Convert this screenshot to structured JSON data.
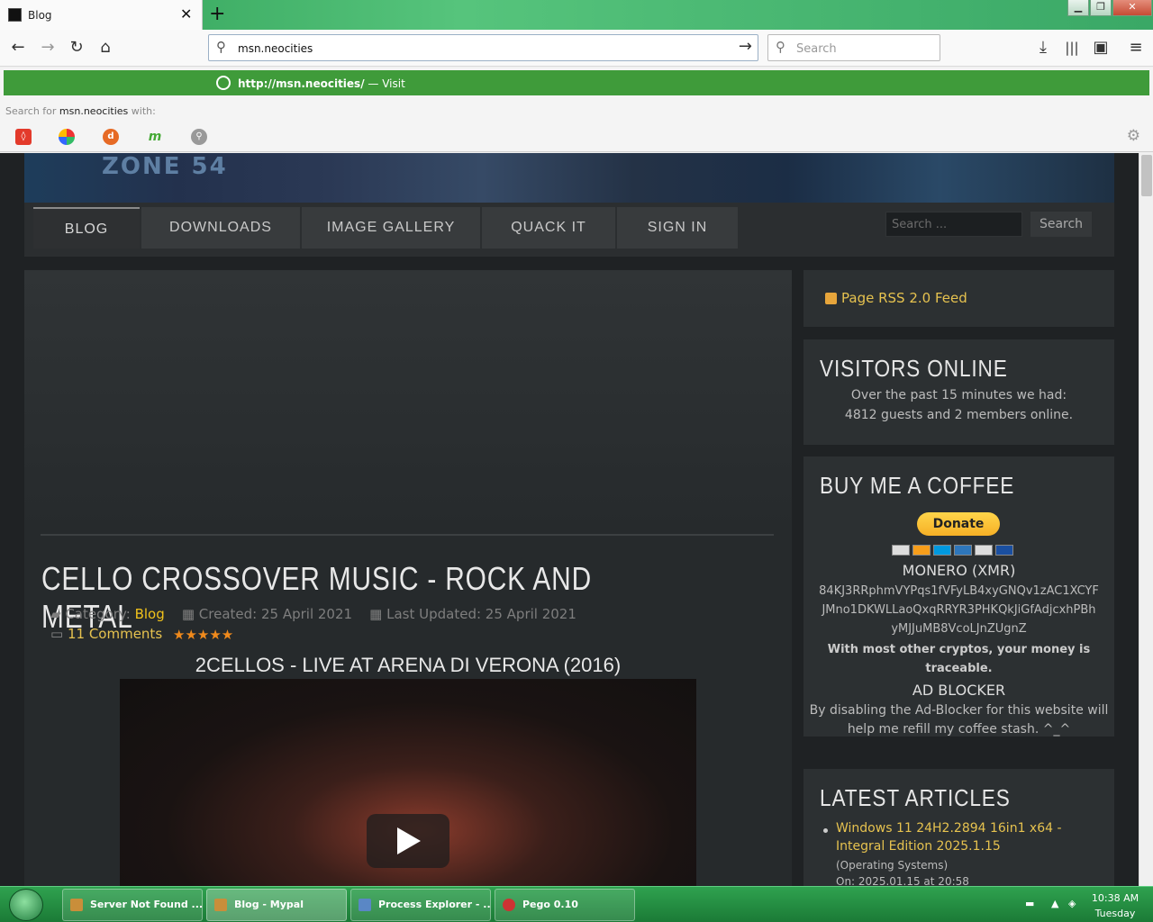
{
  "browser": {
    "tab_title": "Blog",
    "tab_close": "✕",
    "new_tab": "+",
    "url": "msn.neocities",
    "search_placeholder": "Search",
    "dropdown": {
      "visit_url_bold": "http://msn.neocities/",
      "visit_suffix": " — Visit",
      "search_for_prefix": "Search for ",
      "search_for_term": "msn.neocities",
      "search_for_suffix": " with:"
    },
    "window_buttons": {
      "minimize": "▁",
      "maximize": "❐",
      "close": "✕"
    }
  },
  "site": {
    "banner_logo": "ZONE 54",
    "menu": [
      "BLOG",
      "DOWNLOADS",
      "IMAGE GALLERY",
      "QUACK IT",
      "SIGN IN"
    ],
    "search_placeholder": "Search ...",
    "search_button": "Search",
    "article": {
      "title": "CELLO CROSSOVER MUSIC - ROCK AND METAL",
      "category_label": "Category: ",
      "category": "Blog",
      "created": "Created: 25 April 2021",
      "updated": "Last Updated: 25 April 2021",
      "comments": "11 Comments",
      "rating_stars": "★★★★★",
      "video_title": "2CELLOS - LIVE AT ARENA DI VERONA (2016)"
    },
    "sidebar": {
      "rss": "Page RSS 2.0 Feed",
      "visitors_title": "VISITORS ONLINE",
      "visitors_line1": "Over the past 15 minutes we had:",
      "visitors_line2": "4812 guests and 2 members online.",
      "coffee_title": "BUY ME A COFFEE",
      "donate": "Donate",
      "monero_title": "MONERO (XMR)",
      "monero_addr1": "84KJ3RRphmVYPqs1fVFyLB4xyGNQv1zAC1XCYF",
      "monero_addr2": "JMno1DKWLLaoQxqRRYR3PHKQkJiGfAdjcxhPBh",
      "monero_addr3": "yMJJuMB8VcoLJnZUgnZ",
      "crypto_note1": "With most other cryptos, your money is",
      "crypto_note2": "traceable.",
      "adblock_title": "AD BLOCKER",
      "adblock_line1": "By disabling the Ad-Blocker for this website will",
      "adblock_line2": "help me refill my coffee stash. ^_^",
      "latest_title": "LATEST ARTICLES",
      "latest_item_line1": "Windows 11 24H2.2894 16in1 x64 -",
      "latest_item_line2": "Integral Edition 2025.1.15",
      "latest_item_category": "(Operating Systems)",
      "latest_item_date": "On: 2025.01.15 at 20:58"
    }
  },
  "taskbar": {
    "items": [
      "Server Not Found ...",
      "Blog - Mypal",
      "Process Explorer - ...",
      "Pego 0.10"
    ],
    "time": "10:38 AM",
    "day": "Tuesday"
  },
  "colors": {
    "accent": "#e6c24f",
    "titlebar": "#3aa866",
    "visit_row": "#3f9b3a"
  }
}
